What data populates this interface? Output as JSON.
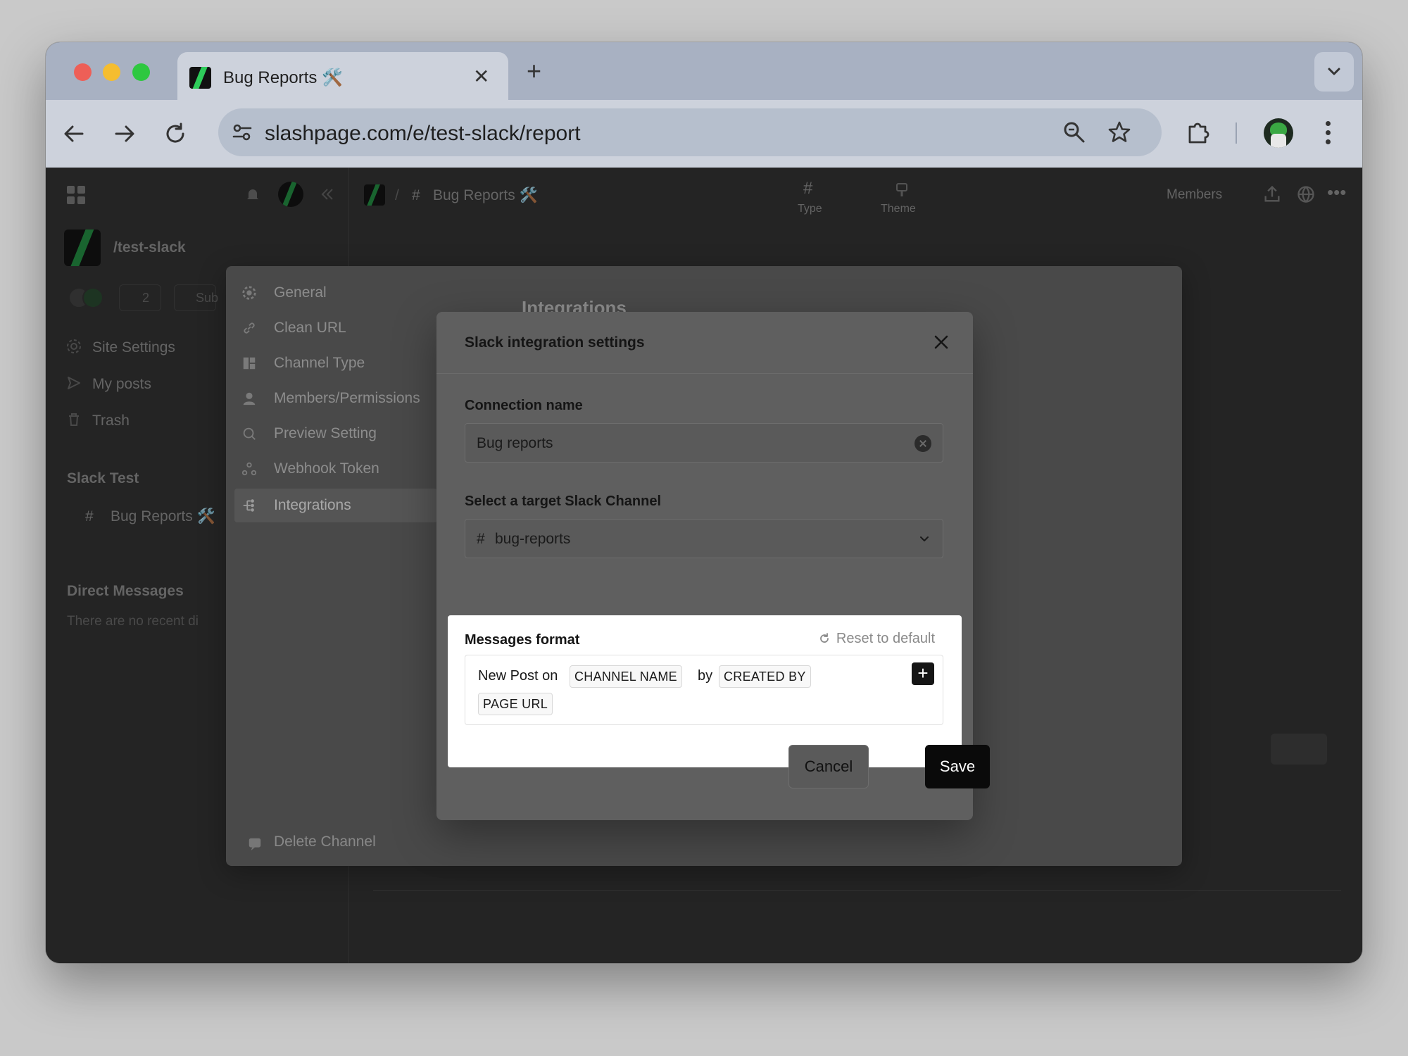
{
  "browser": {
    "tab_title": "Bug Reports 🛠️",
    "url": "slashpage.com/e/test-slack/report"
  },
  "app": {
    "breadcrumb_sep": "/",
    "channel_title": "Bug Reports 🛠️",
    "top_tabs": [
      {
        "label": "Type"
      },
      {
        "label": "Theme"
      }
    ],
    "members_label": "Members",
    "workspace_name": "/test-slack",
    "member_count": "2",
    "subscribe_label": "Sub",
    "nav": [
      {
        "label": "Site Settings"
      },
      {
        "label": "My posts"
      },
      {
        "label": "Trash"
      }
    ],
    "section_title": "Slack Test",
    "channel_item": "Bug Reports 🛠️",
    "dm_title": "Direct Messages",
    "dm_empty": "There are no recent di"
  },
  "settings": {
    "menu": [
      {
        "label": "General"
      },
      {
        "label": "Clean URL"
      },
      {
        "label": "Channel Type"
      },
      {
        "label": "Members/Permissions"
      },
      {
        "label": "Preview Setting"
      },
      {
        "label": "Webhook Token"
      },
      {
        "label": "Integrations"
      }
    ],
    "heading": "Integrations",
    "delete_label": "Delete Channel"
  },
  "modal": {
    "title": "Slack integration settings",
    "connection_label": "Connection name",
    "connection_value": "Bug reports",
    "channel_label": "Select a target Slack Channel",
    "channel_value": "bug-reports",
    "format_label": "Messages format",
    "reset_label": "Reset to default",
    "format_text_1": "New Post on",
    "format_chip_1": "CHANNEL NAME",
    "format_text_2": "by",
    "format_chip_2": "CREATED BY",
    "format_chip_3": "PAGE URL",
    "add_label": "+",
    "cancel_label": "Cancel",
    "save_label": "Save"
  }
}
